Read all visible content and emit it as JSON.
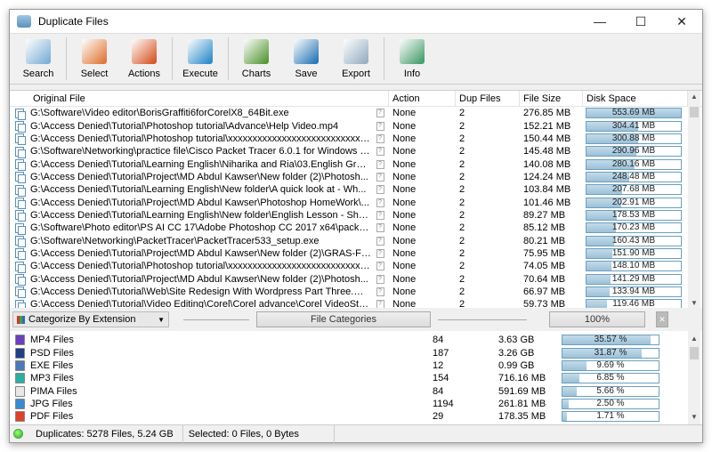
{
  "window": {
    "title": "Duplicate Files",
    "minimize": "—",
    "maximize": "☐",
    "close": "✕"
  },
  "toolbar": [
    {
      "label": "Search",
      "icon": "search-icon",
      "color": "#7fb0d8"
    },
    {
      "label": "Select",
      "icon": "select-icon",
      "color": "#e07a3a"
    },
    {
      "label": "Actions",
      "icon": "actions-icon",
      "color": "#d85a2a"
    },
    {
      "label": "Execute",
      "icon": "play-icon",
      "color": "#2f8fc9"
    },
    {
      "label": "Charts",
      "icon": "pie-chart-icon",
      "color": "#5a9a3a"
    },
    {
      "label": "Save",
      "icon": "floppy-icon",
      "color": "#2c7ab8"
    },
    {
      "label": "Export",
      "icon": "table-icon",
      "color": "#9ab0c4"
    },
    {
      "label": "Info",
      "icon": "info-panel-icon",
      "color": "#4aa070"
    }
  ],
  "columns": {
    "original": "Original File",
    "action": "Action",
    "dup": "Dup Files",
    "size": "File Size",
    "disk": "Disk Space"
  },
  "files": [
    {
      "path": "G:\\Software\\Video editor\\BorisGraffiti6forCorelX8_64Bit.exe",
      "action": "None",
      "dup": "2",
      "size": "276.85 MB",
      "disk": "553.69 MB",
      "diskValue": 553.69
    },
    {
      "path": "G:\\Access Denied\\Tutorial\\Photoshop tutorial\\Advance\\Help Video.mp4",
      "action": "None",
      "dup": "2",
      "size": "152.21 MB",
      "disk": "304.41 MB",
      "diskValue": 304.41
    },
    {
      "path": "G:\\Access Denied\\Tutorial\\Photoshop tutorial\\xxxxxxxxxxxxxxxxxxxxxxxxxxxxx\\T...",
      "action": "None",
      "dup": "2",
      "size": "150.44 MB",
      "disk": "300.88 MB",
      "diskValue": 300.88
    },
    {
      "path": "G:\\Software\\Networking\\practice file\\Cisco Packet Tracer 6.0.1 for Windows (...",
      "action": "None",
      "dup": "2",
      "size": "145.48 MB",
      "disk": "290.96 MB",
      "diskValue": 290.96
    },
    {
      "path": "G:\\Access Denied\\Tutorial\\Learning English\\Niharika and Ria\\03.English Gram...",
      "action": "None",
      "dup": "2",
      "size": "140.08 MB",
      "disk": "280.16 MB",
      "diskValue": 280.16
    },
    {
      "path": "G:\\Access Denied\\Tutorial\\Project\\MD Abdul Kawser\\New folder (2)\\Photosh...",
      "action": "None",
      "dup": "2",
      "size": "124.24 MB",
      "disk": "248.48 MB",
      "diskValue": 248.48
    },
    {
      "path": "G:\\Access Denied\\Tutorial\\Learning English\\New folder\\A quick look at - Wh...",
      "action": "None",
      "dup": "2",
      "size": "103.84 MB",
      "disk": "207.68 MB",
      "diskValue": 207.68
    },
    {
      "path": "G:\\Access Denied\\Tutorial\\Project\\MD Abdul Kawser\\Photoshop HomeWork\\...",
      "action": "None",
      "dup": "2",
      "size": "101.46 MB",
      "disk": "202.91 MB",
      "diskValue": 202.91
    },
    {
      "path": "G:\\Access Denied\\Tutorial\\Learning English\\New folder\\English Lesson - Sho...",
      "action": "None",
      "dup": "2",
      "size": "89.27 MB",
      "disk": "178.53 MB",
      "diskValue": 178.53
    },
    {
      "path": "G:\\Software\\Photo editor\\PS AI CC 17\\Adobe Photoshop CC 2017 x64\\packag...",
      "action": "None",
      "dup": "2",
      "size": "85.12 MB",
      "disk": "170.23 MB",
      "diskValue": 170.23
    },
    {
      "path": "G:\\Software\\Networking\\PacketTracer\\PacketTracer533_setup.exe",
      "action": "None",
      "dup": "2",
      "size": "80.21 MB",
      "disk": "160.43 MB",
      "diskValue": 160.43
    },
    {
      "path": "G:\\Access Denied\\Tutorial\\Project\\MD Abdul Kawser\\New folder (2)\\GRAS-FE...",
      "action": "None",
      "dup": "2",
      "size": "75.95 MB",
      "disk": "151.90 MB",
      "diskValue": 151.9
    },
    {
      "path": "G:\\Access Denied\\Tutorial\\Photoshop tutorial\\xxxxxxxxxxxxxxxxxxxxxxxxxxxxx\\T...",
      "action": "None",
      "dup": "2",
      "size": "74.05 MB",
      "disk": "148.10 MB",
      "diskValue": 148.1
    },
    {
      "path": "G:\\Access Denied\\Tutorial\\Project\\MD Abdul Kawser\\New folder (2)\\Photosh...",
      "action": "None",
      "dup": "2",
      "size": "70.64 MB",
      "disk": "141.29 MB",
      "diskValue": 141.29
    },
    {
      "path": "G:\\Access Denied\\Tutorial\\Web\\Site Redesign With Wordpress Part Three.mp4",
      "action": "None",
      "dup": "2",
      "size": "66.97 MB",
      "disk": "133.94 MB",
      "diskValue": 133.94
    },
    {
      "path": "G:\\Access Denied\\Tutorial\\Video Editing\\Corel\\Corel advance\\Corel VideoStu...",
      "action": "None",
      "dup": "2",
      "size": "59.73 MB",
      "disk": "119.46 MB",
      "diskValue": 119.46
    }
  ],
  "categorize": {
    "selected": "Categorize By Extension",
    "file_categories": "File Categories",
    "zoom": "100%"
  },
  "categories": [
    {
      "name": "MP4 Files",
      "count": "84",
      "size": "3.63 GB",
      "percent": "35.57 %",
      "value": 35.57,
      "color": "#6a3fc0"
    },
    {
      "name": "PSD Files",
      "count": "187",
      "size": "3.26 GB",
      "percent": "31.87 %",
      "value": 31.87,
      "color": "#1f3f8a"
    },
    {
      "name": "EXE Files",
      "count": "12",
      "size": "0.99 GB",
      "percent": "9.69 %",
      "value": 9.69,
      "color": "#4a7ab8"
    },
    {
      "name": "MP3 Files",
      "count": "154",
      "size": "716.16 MB",
      "percent": "6.85 %",
      "value": 6.85,
      "color": "#2ab0a0"
    },
    {
      "name": "PIMA Files",
      "count": "84",
      "size": "591.69 MB",
      "percent": "5.66 %",
      "value": 5.66,
      "color": "#e8e8e8"
    },
    {
      "name": "JPG Files",
      "count": "1194",
      "size": "261.81 MB",
      "percent": "2.50 %",
      "value": 2.5,
      "color": "#3a8ad0"
    },
    {
      "name": "PDF Files",
      "count": "29",
      "size": "178.35 MB",
      "percent": "1.71 %",
      "value": 1.71,
      "color": "#e0402a"
    }
  ],
  "status": {
    "duplicates": "Duplicates: 5278 Files, 5.24 GB",
    "selected": "Selected: 0 Files, 0 Bytes"
  }
}
